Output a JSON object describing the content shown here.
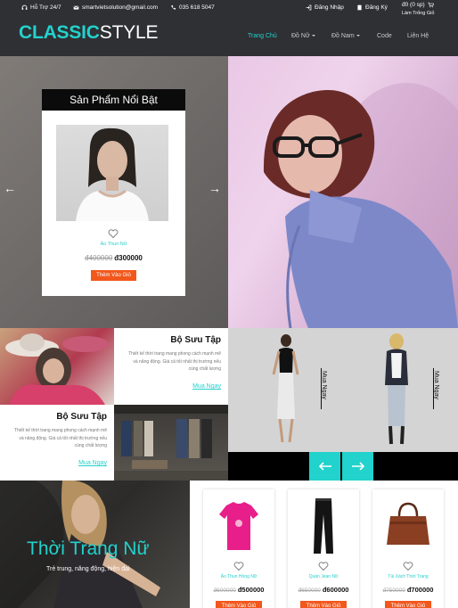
{
  "topbar": {
    "support": "Hỗ Trợ 24/7",
    "email": "smartvietsolution@gmail.com",
    "phone": "035 618 5047",
    "login": "Đăng Nhập",
    "register": "Đăng Ký",
    "cart": "đ0 (0 sp)",
    "cart_clear": "Làm Trống Giỏ"
  },
  "header": {
    "logo_a": "CLASSIC",
    "logo_b": "STYLE",
    "nav": [
      {
        "label": "Trang Chủ",
        "active": true,
        "dropdown": false
      },
      {
        "label": "Đồ Nữ",
        "active": false,
        "dropdown": true
      },
      {
        "label": "Đồ Nam",
        "active": false,
        "dropdown": true
      },
      {
        "label": "Code",
        "active": false,
        "dropdown": false
      },
      {
        "label": "Liên Hệ",
        "active": false,
        "dropdown": false
      }
    ]
  },
  "featured": {
    "title": "Sản Phẩm Nổi Bật",
    "product_name": "Áo Thun Nữ",
    "old_price": "đ400000",
    "new_price": "đ300000",
    "button": "Thêm Vào Giỏ"
  },
  "collections": [
    {
      "title": "Bộ Sưu Tập",
      "desc": "Thiết kế thời trang mang phong cách mạnh mẽ và năng động. Giá cả tốt nhất thị trường nếu cùng chất lượng",
      "link": "Mua Ngay"
    },
    {
      "title": "Bộ Sưu Tập",
      "desc": "Thiết kế thời trang mang phong cách mạnh mẽ và năng động. Giá cả tốt nhất thị trường nếu cùng chất lượng",
      "link": "Mua Ngay"
    }
  ],
  "models": {
    "buy_1": "Mua Ngay",
    "buy_2": "Mua Ngay"
  },
  "women": {
    "title": "Thời Trang Nữ",
    "subtitle": "Trẻ trung, năng động, hiện đại"
  },
  "products": [
    {
      "name": "Áo Thun Hồng Nữ",
      "old_price": "đ600000",
      "new_price": "đ500000",
      "button": "Thêm Vào Giỏ"
    },
    {
      "name": "Quần Jean Nữ",
      "old_price": "đ650000",
      "new_price": "đ600000",
      "button": "Thêm Vào Giỏ"
    },
    {
      "name": "Túi Xách Thời Trang",
      "old_price": "đ750000",
      "new_price": "đ700000",
      "button": "Thêm Vào Giỏ"
    }
  ],
  "colors": {
    "accent": "#22d2cc",
    "header": "#2f3034",
    "button": "#f2571c"
  }
}
